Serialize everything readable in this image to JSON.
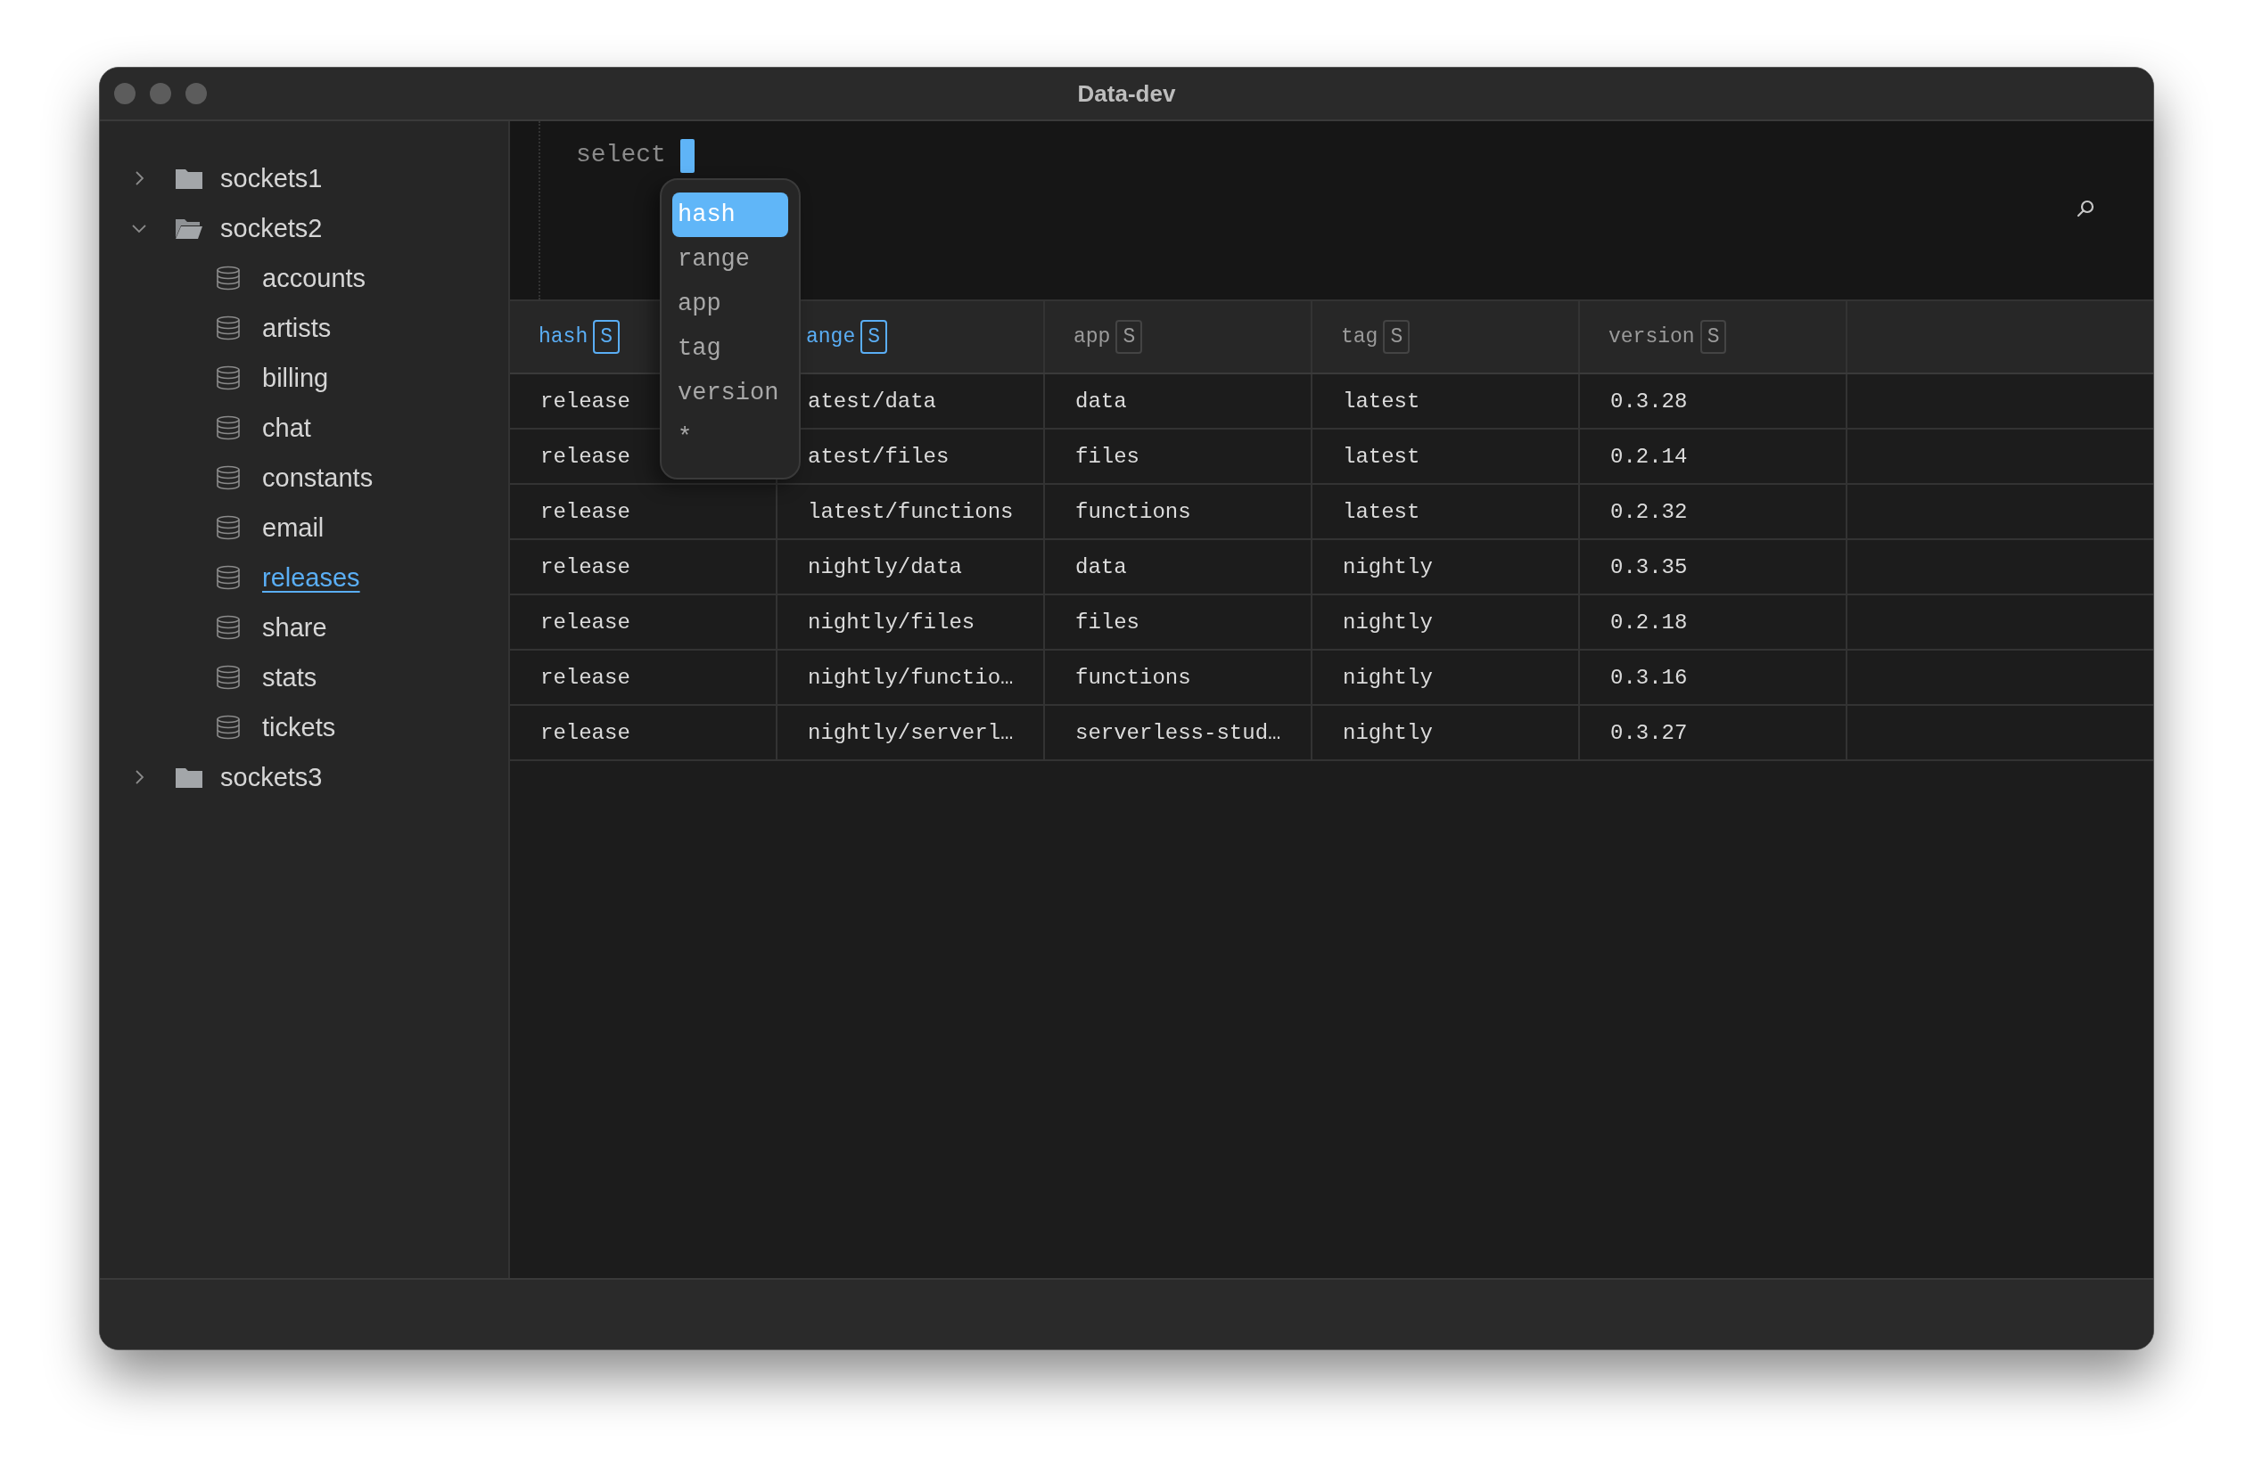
{
  "window": {
    "title": "Data-dev"
  },
  "sidebar": {
    "items": [
      {
        "label": "sockets1",
        "expanded": false
      },
      {
        "label": "sockets2",
        "expanded": true,
        "children": [
          {
            "label": "accounts",
            "selected": false
          },
          {
            "label": "artists",
            "selected": false
          },
          {
            "label": "billing",
            "selected": false
          },
          {
            "label": "chat",
            "selected": false
          },
          {
            "label": "constants",
            "selected": false
          },
          {
            "label": "email",
            "selected": false
          },
          {
            "label": "releases",
            "selected": true
          },
          {
            "label": "share",
            "selected": false
          },
          {
            "label": "stats",
            "selected": false
          },
          {
            "label": "tickets",
            "selected": false
          }
        ]
      },
      {
        "label": "sockets3",
        "expanded": false
      }
    ]
  },
  "editor": {
    "text": "select"
  },
  "autocomplete": {
    "items": [
      {
        "label": "hash",
        "selected": true
      },
      {
        "label": "range",
        "selected": false
      },
      {
        "label": "app",
        "selected": false
      },
      {
        "label": "tag",
        "selected": false
      },
      {
        "label": "version",
        "selected": false
      },
      {
        "label": "*",
        "selected": false
      }
    ]
  },
  "table": {
    "columns": [
      {
        "label": "hash",
        "type": "S",
        "active": true
      },
      {
        "label": "ange",
        "type": "S",
        "active": true
      },
      {
        "label": "app",
        "type": "S",
        "active": false
      },
      {
        "label": "tag",
        "type": "S",
        "active": false
      },
      {
        "label": "version",
        "type": "S",
        "active": false
      }
    ],
    "rows": [
      [
        "release",
        "atest/data",
        "data",
        "latest",
        "0.3.28"
      ],
      [
        "release",
        "atest/files",
        "files",
        "latest",
        "0.2.14"
      ],
      [
        "release",
        "latest/functions",
        "functions",
        "latest",
        "0.2.32"
      ],
      [
        "release",
        "nightly/data",
        "data",
        "nightly",
        "0.3.35"
      ],
      [
        "release",
        "nightly/files",
        "files",
        "nightly",
        "0.2.18"
      ],
      [
        "release",
        "nightly/functio…",
        "functions",
        "nightly",
        "0.3.16"
      ],
      [
        "release",
        "nightly/serverl…",
        "serverless-stud…",
        "nightly",
        "0.3.27"
      ]
    ]
  }
}
